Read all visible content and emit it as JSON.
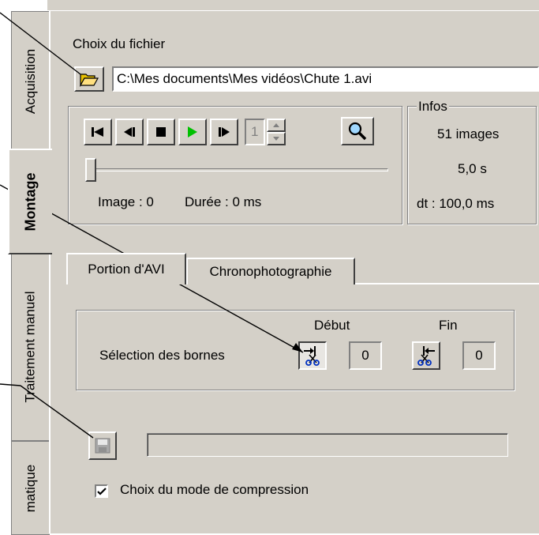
{
  "tabs_vertical": [
    "Acquisition",
    "Montage",
    "Traitement manuel",
    "matique"
  ],
  "file": {
    "label": "Choix du fichier",
    "path": "C:\\Mes documents\\Mes vidéos\\Chute 1.avi"
  },
  "player": {
    "frame_spin_value": "1",
    "image_label": "Image : 0",
    "duration_label": "Durée : 0 ms",
    "slider_position": 0
  },
  "infos": {
    "title": "Infos",
    "images": "51 images",
    "duration": "5,0 s",
    "dt": "dt : 100,0 ms"
  },
  "subtabs": [
    "Portion d'AVI",
    "Chronophotographie"
  ],
  "bornes": {
    "label": "Sélection des bornes",
    "debut_label": "Début",
    "debut_value": "0",
    "fin_label": "Fin",
    "fin_value": "0"
  },
  "compression": {
    "checkbox_label": "Choix du mode de compression",
    "checked": true
  },
  "colors": {
    "panel": "#d4d0c8",
    "annotation": "#e00000",
    "play": "#00c000"
  }
}
